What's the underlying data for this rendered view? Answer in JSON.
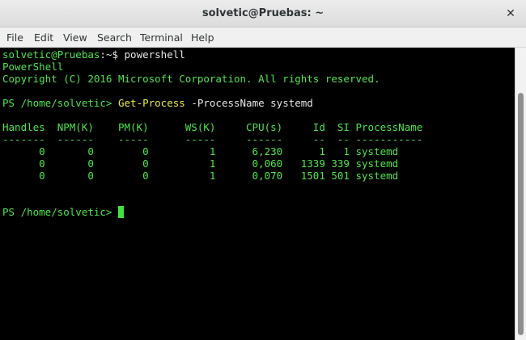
{
  "window": {
    "title": "solvetic@Pruebas: ~",
    "close_icon": "close-icon"
  },
  "menu": [
    "File",
    "Edit",
    "View",
    "Search",
    "Terminal",
    "Help"
  ],
  "terminal": {
    "prompt_user": "solvetic@Pruebas",
    "prompt_rest": ":~$ powershell",
    "banner_1": "PowerShell",
    "banner_2": "Copyright (C) 2016 Microsoft Corporation. All rights reserved.",
    "ps_prompt": "PS /home/solvetic> ",
    "command": "Get-Process",
    "command_args": " -ProcessName systemd",
    "table_header": "Handles  NPM(K)    PM(K)      WS(K)     CPU(s)     Id  SI ProcessName",
    "table_rule": "-------  ------    -----      -----     ------     --  -- -----------",
    "rows": [
      "      0       0        0          1      6,230      1   1 systemd",
      "      0       0        0          1      0,060   1339 339 systemd",
      "      0       0        0          1      0,070   1501 501 systemd"
    ],
    "final_prompt": "PS /home/solvetic> "
  }
}
